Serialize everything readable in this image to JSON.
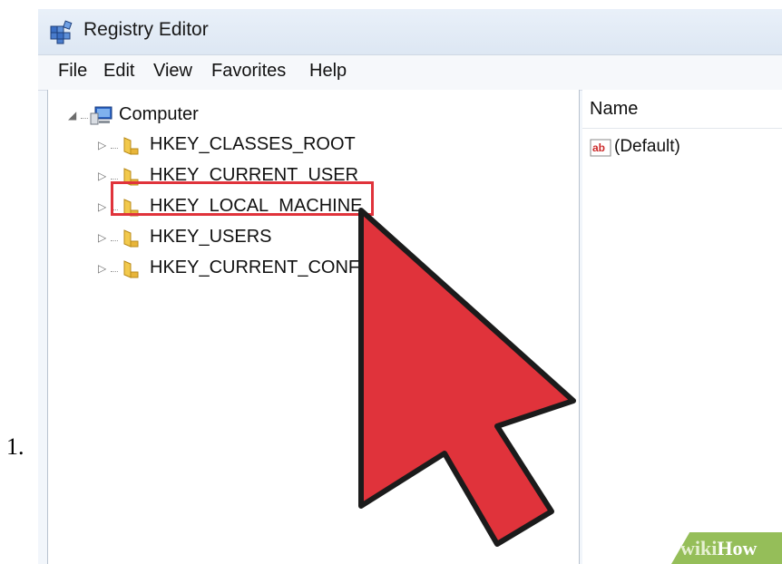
{
  "step_number": "1.",
  "window": {
    "title": "Registry Editor",
    "icon": "registry-editor-icon"
  },
  "menu": [
    {
      "label": "File"
    },
    {
      "label": "Edit"
    },
    {
      "label": "View"
    },
    {
      "label": "Favorites"
    },
    {
      "label": "Help"
    }
  ],
  "tree": {
    "root": {
      "label": "Computer",
      "expander": "expanded",
      "icon": "computer-icon"
    },
    "children": [
      {
        "label": "HKEY_CLASSES_ROOT",
        "expander": "collapsed",
        "icon": "folder-icon"
      },
      {
        "label": "HKEY_CURRENT_USER",
        "expander": "collapsed",
        "icon": "folder-icon"
      },
      {
        "label": "HKEY_LOCAL_MACHINE",
        "expander": "collapsed",
        "icon": "folder-icon",
        "highlighted": true
      },
      {
        "label": "HKEY_USERS",
        "expander": "collapsed",
        "icon": "folder-icon"
      },
      {
        "label": "HKEY_CURRENT_CONFI",
        "expander": "collapsed",
        "icon": "folder-icon"
      }
    ]
  },
  "list": {
    "column_header": "Name",
    "rows": [
      {
        "name": "(Default)",
        "icon": "string-value-icon"
      }
    ]
  },
  "overlay": {
    "highlight_color": "#e0333b",
    "cursor_color": "#e0333b",
    "cursor_icon": "pointer-arrow-icon"
  },
  "watermark": {
    "part1": "wiki",
    "part2": "How",
    "color": "#95be59"
  }
}
